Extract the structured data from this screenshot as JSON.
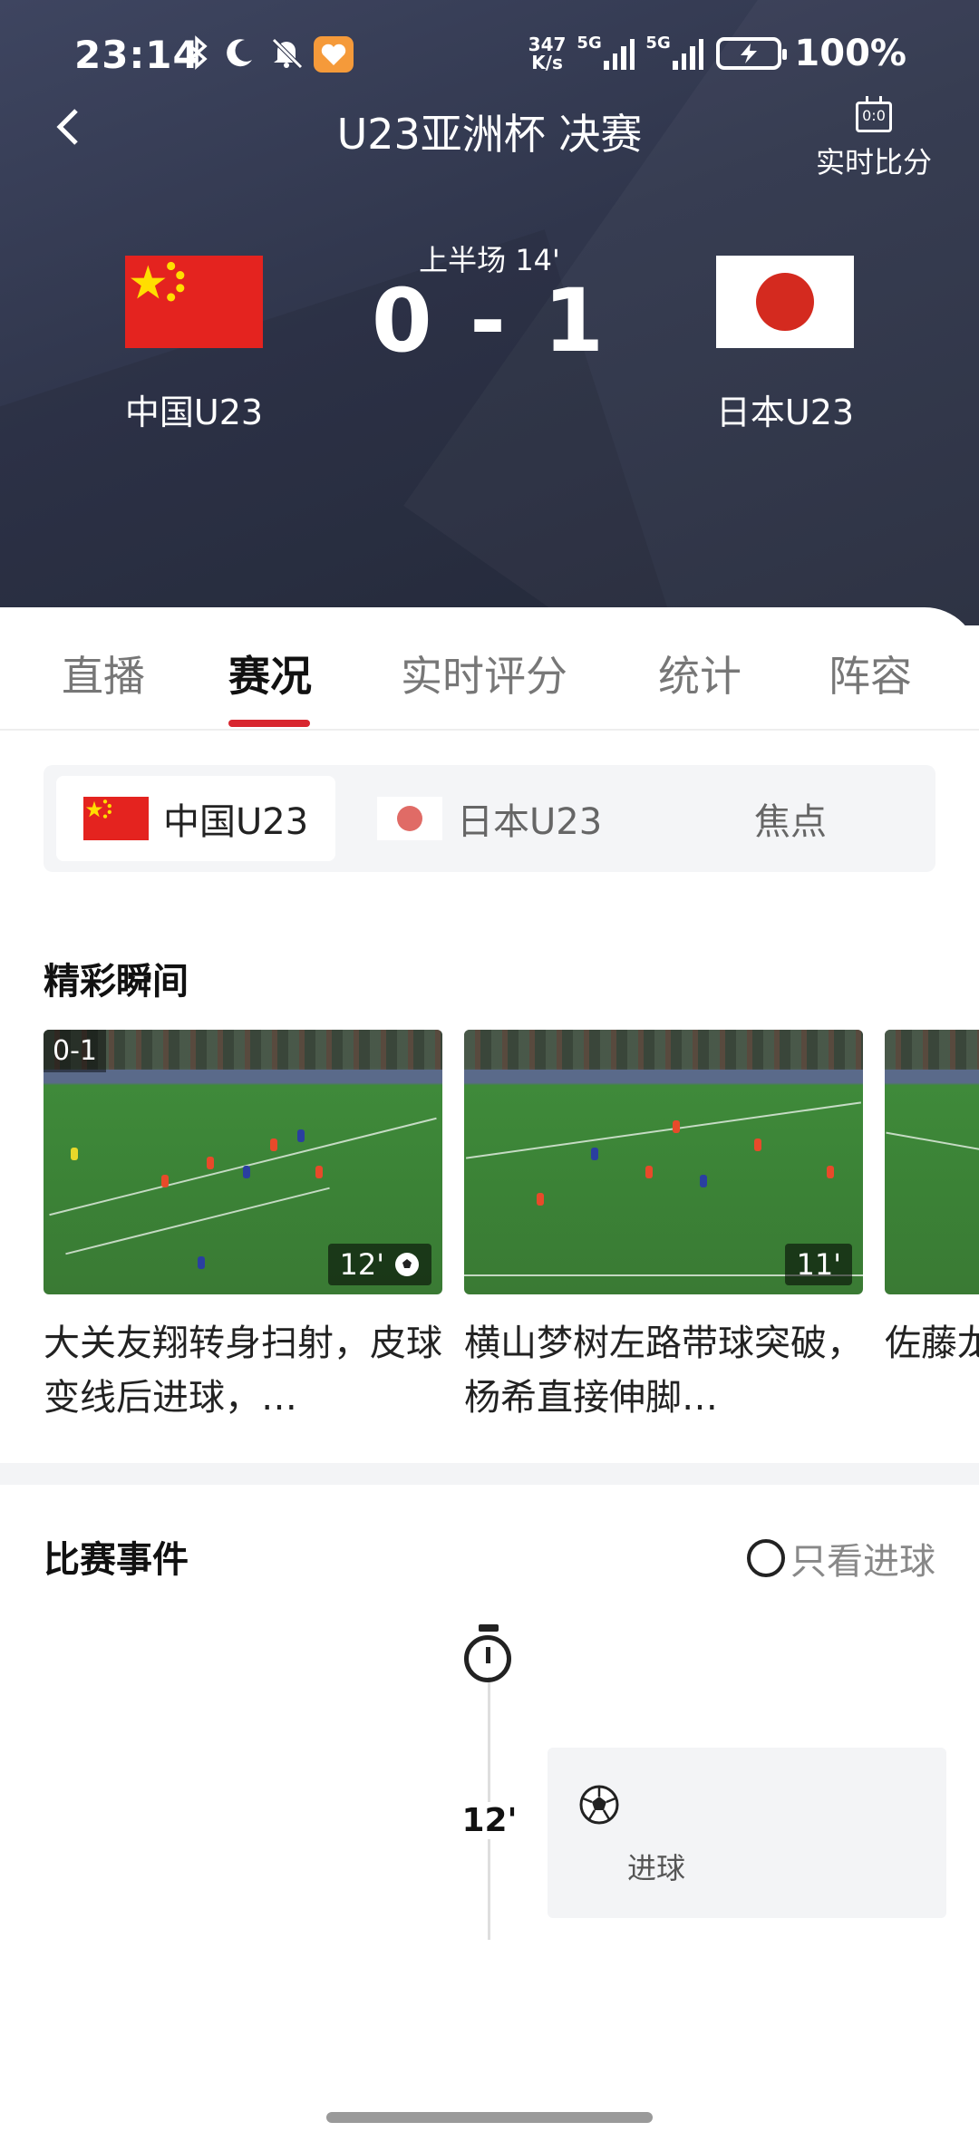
{
  "status_bar": {
    "time": "23:14",
    "icons": [
      "bluetooth-icon",
      "moon-icon",
      "bell-off-icon",
      "app-heart-icon"
    ],
    "net_speed_value": "347",
    "net_speed_unit": "K/s",
    "signal1_label": "5G",
    "signal2_label": "5G",
    "battery_percent": "100%"
  },
  "header": {
    "title": "U23亚洲杯 决赛",
    "live_score_label": "实时比分",
    "live_score_icon_text": "0:0",
    "match_period": "上半场 14'",
    "score": "0 - 1",
    "home_team": "中国U23",
    "away_team": "日本U23"
  },
  "tabs": [
    {
      "label": "直播"
    },
    {
      "label": "赛况",
      "active": true
    },
    {
      "label": "实时评分"
    },
    {
      "label": "统计"
    },
    {
      "label": "阵容"
    }
  ],
  "team_switch": [
    {
      "label": "中国U23",
      "active": true
    },
    {
      "label": "日本U23"
    },
    {
      "label": "焦点"
    }
  ],
  "highlights": {
    "title": "精彩瞬间",
    "items": [
      {
        "score_badge": "0-1",
        "minute": "12'",
        "text": "大关友翔转身扫射，皮球变线后进球，…"
      },
      {
        "minute": "11'",
        "text": "横山梦树左路带球突破，杨希直接伸脚…"
      },
      {
        "text": "佐藤龙之介…区，古…"
      }
    ]
  },
  "events": {
    "title": "比赛事件",
    "goals_only_label": "只看进球",
    "items": [
      {
        "minute": "12'",
        "type_label": "进球",
        "icon": "soccer-ball-icon"
      }
    ]
  },
  "colors": {
    "header_bg": "#30364c",
    "accent_red": "#d8262f",
    "china_red": "#e4231f",
    "japan_red": "#d42a1f"
  }
}
